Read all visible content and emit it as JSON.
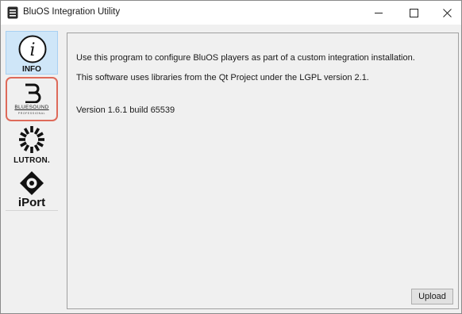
{
  "window": {
    "title": "BluOS Integration Utility"
  },
  "sidebar": {
    "items": [
      {
        "id": "info",
        "label": "INFO",
        "selected": true
      },
      {
        "id": "bluesound",
        "label": "BLUESOUND",
        "sublabel": "PROFESSIONAL"
      },
      {
        "id": "lutron",
        "label": "LUTRON."
      },
      {
        "id": "iport",
        "label": "iPort"
      }
    ]
  },
  "content": {
    "lines": [
      "Use this program to configure BluOS players as part of a custom integration installation.",
      "This software uses libraries from the Qt Project under the LGPL version 2.1.",
      "Version 1.6.1 build 65539"
    ],
    "upload_label": "Upload"
  },
  "colors": {
    "selected_bg": "#cfe6f8",
    "highlight_border": "#de6a5a"
  },
  "icons": [
    "app-icon",
    "minimize-icon",
    "maximize-icon",
    "close-icon",
    "info-icon",
    "bluesound-logo-icon",
    "lutron-logo-icon",
    "iport-logo-icon"
  ]
}
